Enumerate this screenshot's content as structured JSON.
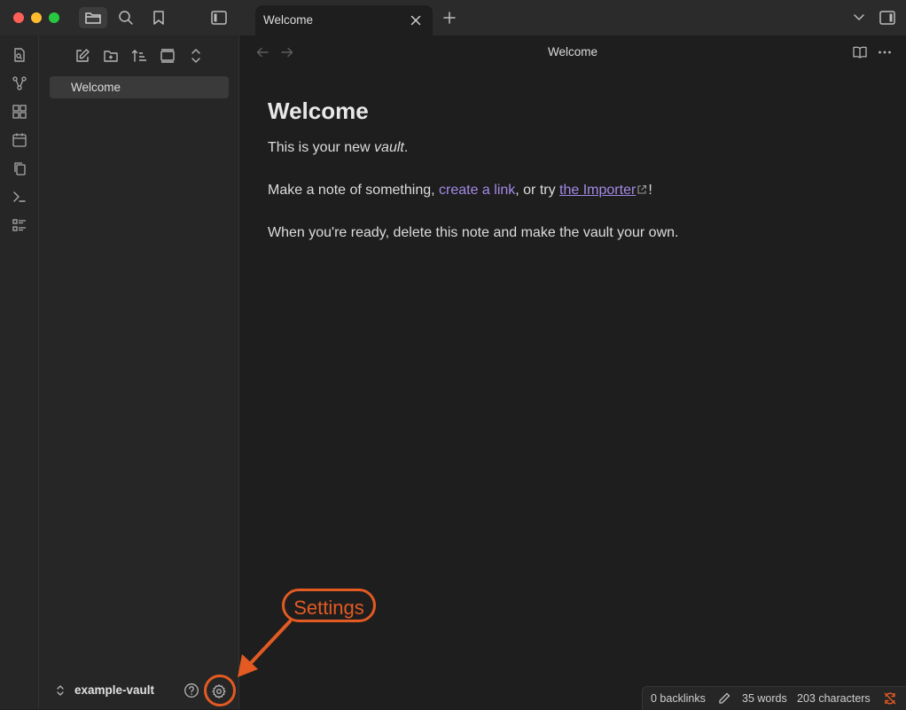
{
  "titlebar": {
    "tab_title": "Welcome"
  },
  "sidebar": {
    "files": [
      {
        "name": "Welcome"
      }
    ],
    "vault_name": "example-vault"
  },
  "main": {
    "header_title": "Welcome",
    "heading": "Welcome",
    "para1_prefix": "This is your new ",
    "para1_em": "vault",
    "para1_suffix": ".",
    "para2_prefix": "Make a note of something, ",
    "para2_link1": "create a link",
    "para2_mid": ", or try ",
    "para2_link2": "the Importer",
    "para2_suffix": "!",
    "para3": "When you're ready, delete this note and make the vault your own."
  },
  "statusbar": {
    "backlinks": "0 backlinks",
    "words": "35 words",
    "characters": "203 characters"
  },
  "annotation": {
    "label": "Settings",
    "color": "#e35a22"
  },
  "colors": {
    "accent": "#a38ae6",
    "background": "#1e1e1e",
    "sidebar": "#262626",
    "sync_error": "#e35a22"
  }
}
